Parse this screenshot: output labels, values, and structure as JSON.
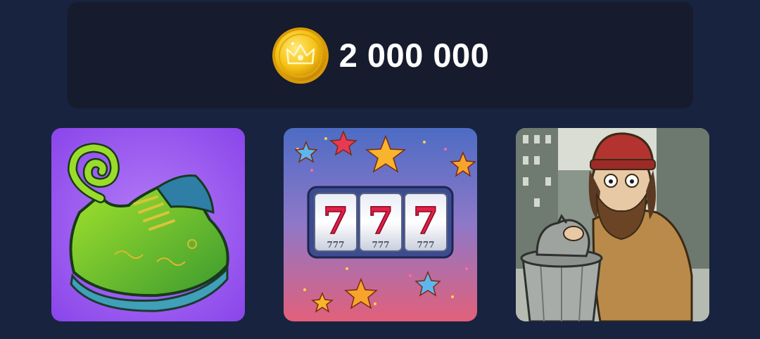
{
  "balance": {
    "icon": "crown-coin-icon",
    "amount": "2 000 000"
  },
  "cards": [
    {
      "name": "shoe-card",
      "icon": "curly-shoe-illustration"
    },
    {
      "name": "slots-card",
      "icon": "slot-machine-777-illustration",
      "reels": [
        "7",
        "7",
        "7"
      ],
      "reel_sub": [
        "777",
        "777",
        "777"
      ]
    },
    {
      "name": "homeless-card",
      "icon": "homeless-man-illustration"
    }
  ],
  "colors": {
    "page_bg": "#18233f",
    "panel_bg": "#161b2d",
    "coin_gold": "#f6c21a",
    "shoe_bg": "#9b57f0",
    "slots_bg": "#6b79c9"
  }
}
